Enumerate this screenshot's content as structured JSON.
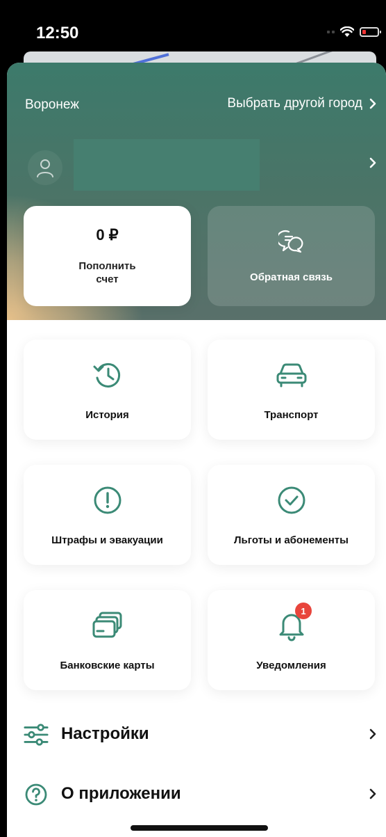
{
  "status_bar": {
    "time": "12:50"
  },
  "header": {
    "city": "Воронеж",
    "choose_city": "Выбрать другой город"
  },
  "balance_card": {
    "amount": "0 ₽",
    "label_line1": "Пополнить",
    "label_line2": "счет"
  },
  "feedback_card": {
    "label": "Обратная связь",
    "icon": "chat-bubbles-icon"
  },
  "tiles": [
    {
      "label": "История",
      "icon": "history-clock-icon"
    },
    {
      "label": "Транспорт",
      "icon": "car-icon"
    },
    {
      "label": "Штрафы и эвакуации",
      "icon": "exclamation-circle-icon"
    },
    {
      "label": "Льготы и абонементы",
      "icon": "check-circle-icon"
    },
    {
      "label": "Банковские карты",
      "icon": "bank-cards-icon"
    },
    {
      "label": "Уведомления",
      "icon": "bell-icon",
      "badge": "1"
    }
  ],
  "menu": [
    {
      "label": "Настройки",
      "icon": "sliders-icon"
    },
    {
      "label": "О приложении",
      "icon": "question-circle-icon"
    }
  ],
  "colors": {
    "accent": "#3b8a76",
    "badge": "#e8453c",
    "hero_top": "#3c7a6b",
    "hero_glow": "#e6c08a"
  }
}
